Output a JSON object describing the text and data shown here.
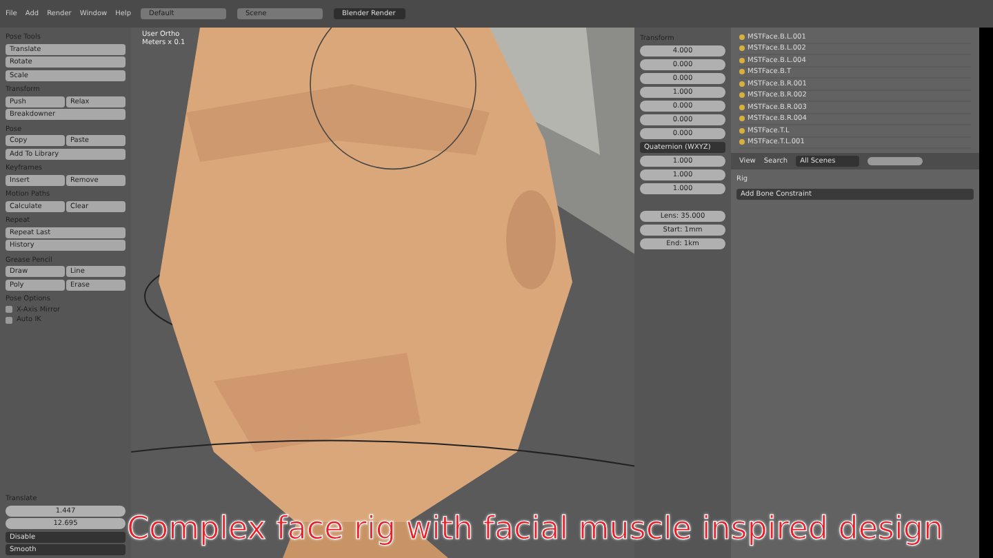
{
  "header": {
    "menus": [
      "File",
      "Add",
      "Render",
      "Window",
      "Help"
    ],
    "layout": "Default",
    "scene": "Scene",
    "engine": "Blender Render"
  },
  "toolbar": [
    {
      "title": "Pose Tools",
      "rows": [
        [
          "Translate"
        ],
        [
          "Rotate"
        ],
        [
          "Scale"
        ]
      ]
    },
    {
      "title": "Transform",
      "rows": [
        [
          "Push",
          "Relax"
        ],
        [
          "Breakdowner"
        ]
      ]
    },
    {
      "title": "Pose",
      "rows": [
        [
          "Copy",
          "Paste"
        ],
        [
          "Add To Library"
        ]
      ]
    },
    {
      "title": "Keyframes",
      "rows": [
        [
          "Insert",
          "Remove"
        ]
      ]
    },
    {
      "title": "Motion Paths",
      "rows": [
        [
          "Calculate",
          "Clear"
        ]
      ]
    },
    {
      "title": "Repeat",
      "rows": [
        [
          "Repeat Last"
        ],
        [
          "History"
        ]
      ]
    },
    {
      "title": "Grease Pencil",
      "rows": [
        [
          "Draw",
          "Line"
        ],
        [
          "Poly",
          "Erase"
        ]
      ]
    }
  ],
  "toolbar_lower": [
    {
      "kind": "header",
      "label": "Pose Options"
    },
    {
      "kind": "check",
      "label": "X-Axis Mirror",
      "checked": false
    },
    {
      "kind": "check",
      "label": "Auto IK",
      "checked": false
    }
  ],
  "operator": {
    "title": "Translate",
    "fields": [
      "1.447",
      "12.695"
    ],
    "dropdowns": [
      "Disable",
      "Smooth"
    ]
  },
  "viewport": {
    "view": "User Ortho",
    "units": "Meters x 0.1"
  },
  "npanel": {
    "title": "Transform",
    "values": [
      "4.000",
      "0.000",
      "0.000",
      "1.000",
      "0.000",
      "0.000",
      "0.000",
      "1.000",
      "1.000",
      "1.000"
    ],
    "mode": "Quaternion (WXYZ)",
    "view": [
      "Lens: 35.000",
      "Start: 1mm",
      "End: 1km"
    ]
  },
  "outliner": [
    "MSTFace.B.L.001",
    "MSTFace.B.L.002",
    "MSTFace.B.L.004",
    "MSTFace.B.T",
    "MSTFace.B.R.001",
    "MSTFace.B.R.002",
    "MSTFace.B.R.003",
    "MSTFace.B.R.004",
    "MSTFace.T.L",
    "MSTFace.T.L.001"
  ],
  "outliner_bar": {
    "view": "View",
    "search": "Search",
    "filter": "All Scenes"
  },
  "properties": {
    "bone": "Rig",
    "constraint": "Add Bone Constraint"
  },
  "caption": "Complex face rig with facial muscle inspired design"
}
